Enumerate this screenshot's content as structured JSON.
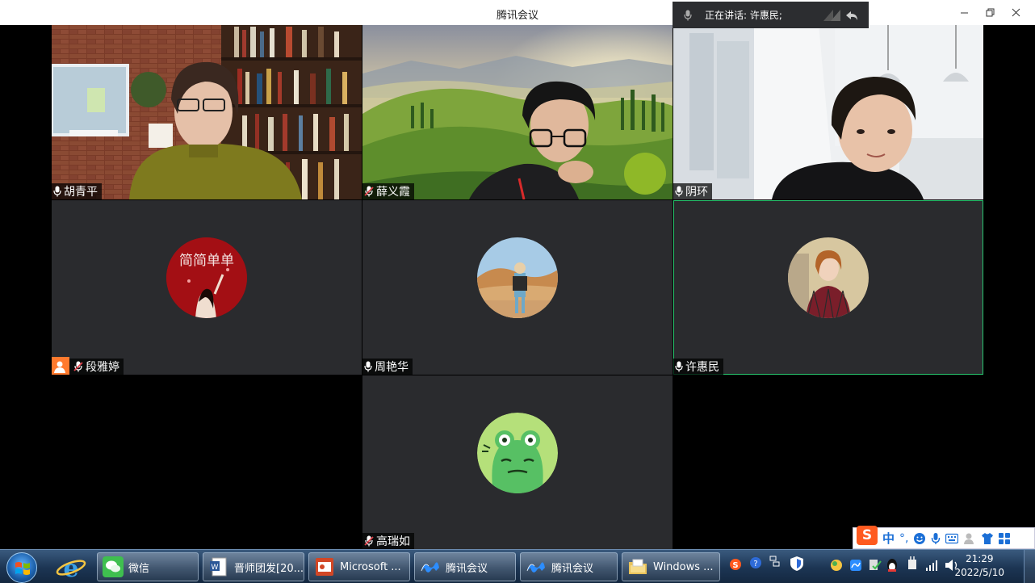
{
  "window": {
    "title": "腾讯会议"
  },
  "speaker_banner": {
    "label": "正在讲话: 许惠民;"
  },
  "window_controls": {
    "minimize": "—",
    "restore": "❐",
    "close": "✕"
  },
  "participants": [
    {
      "name": "胡青平",
      "mic": "on",
      "video": "bookshelf-background"
    },
    {
      "name": "薛义霞",
      "mic": "muted",
      "video": "green-hills-background"
    },
    {
      "name": "阴环",
      "mic": "on",
      "video": "white-room-background"
    },
    {
      "name": "段雅婷",
      "mic": "muted",
      "video": "off",
      "avatar": "red-circle-avatar",
      "avatar_text": "简简单单"
    },
    {
      "name": "周艳华",
      "mic": "on",
      "video": "off",
      "avatar": "desert-photo-avatar"
    },
    {
      "name": "许惠民",
      "mic": "on",
      "video": "off",
      "avatar": "portrait-avatar",
      "speaking": true
    },
    {
      "name": "高瑞如",
      "mic": "muted",
      "video": "off",
      "avatar": "frog-avatar"
    }
  ],
  "taskbar": {
    "items": [
      {
        "label": "微信",
        "icon": "wechat-icon"
      },
      {
        "label": "晋师团发[20...",
        "icon": "word-doc-icon"
      },
      {
        "label": "Microsoft ...",
        "icon": "powerpoint-icon"
      },
      {
        "label": "腾讯会议",
        "icon": "tencent-meeting-icon"
      },
      {
        "label": "腾讯会议",
        "icon": "tencent-meeting-icon"
      },
      {
        "label": "Windows ...",
        "icon": "folder-icon"
      }
    ],
    "clock": {
      "time": "21:29",
      "date": "2022/5/10"
    }
  },
  "ime": {
    "mode": "中",
    "logo": "S",
    "punct": "°,"
  },
  "colors": {
    "active_border": "#28c76f",
    "tile_bg": "#2a2b2e",
    "badge_orange": "#ff7a2e"
  }
}
